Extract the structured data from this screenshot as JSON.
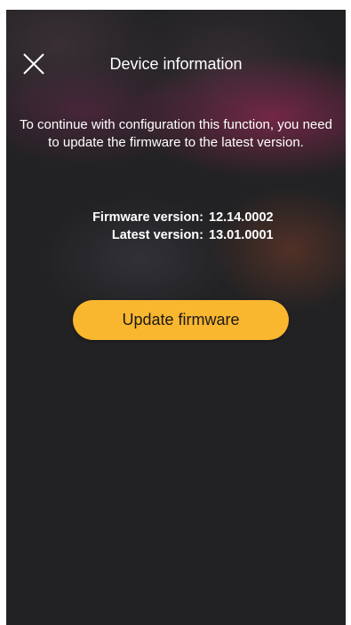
{
  "header": {
    "title": "Device information",
    "close_icon": "close-icon"
  },
  "message": "To continue with configuration this function, you need to update the firmware to the latest version.",
  "versions": {
    "firmware_label": "Firmware version:",
    "firmware_value": "12.14.0002",
    "latest_label": "Latest version:",
    "latest_value": "13.01.0001"
  },
  "actions": {
    "update_label": "Update firmware"
  },
  "colors": {
    "background": "#222224",
    "accent": "#f9b62f",
    "text": "#ffffff"
  }
}
